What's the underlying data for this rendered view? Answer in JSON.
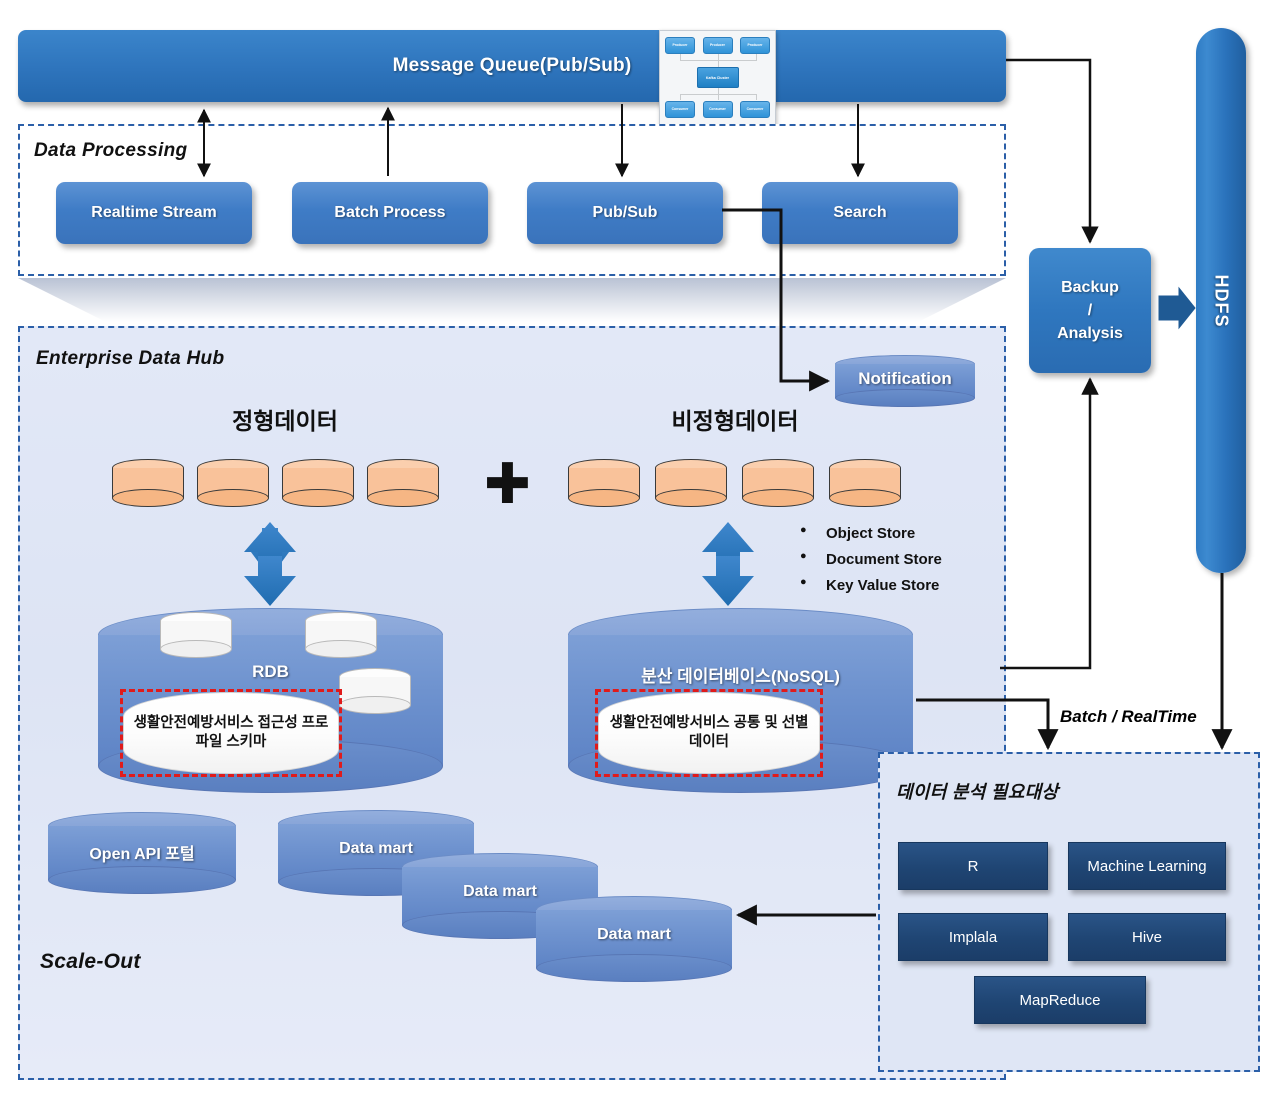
{
  "message_queue": {
    "title": "Message Queue(Pub/Sub)",
    "inset": {
      "name": "kafka-cluster-thumbnail",
      "producers": [
        "Producer",
        "Producer",
        "Producer"
      ],
      "cluster": "Kafka Cluster",
      "consumers": [
        "Consumer",
        "Consumer",
        "Consumer"
      ]
    }
  },
  "data_processing": {
    "title": "Data Processing",
    "boxes": [
      {
        "label": "Realtime Stream"
      },
      {
        "label": "Batch Process"
      },
      {
        "label": "Pub/Sub"
      },
      {
        "label": "Search"
      }
    ]
  },
  "enterprise_data_hub": {
    "title": "Enterprise Data Hub",
    "scale_out": "Scale-Out",
    "structured": {
      "heading": "정형데이터",
      "cylinder_count": 4,
      "db_label": "RDB",
      "highlight": "생활안전예방서비스 접근성 프로파일 스키마"
    },
    "plus": "✚",
    "unstructured": {
      "heading": "비정형데이터",
      "cylinder_count": 4,
      "db_label": "분산 데이터베이스(NoSQL)",
      "highlight": "생활안전예방서비스 공통 및 선별 데이터",
      "store_types": [
        "Object Store",
        "Document Store",
        "Key Value Store"
      ]
    },
    "notification": "Notification",
    "open_api": "Open API 포털",
    "data_marts": [
      "Data mart",
      "Data mart",
      "Data mart"
    ]
  },
  "backup": {
    "lines": [
      "Backup",
      "/",
      "Analysis"
    ]
  },
  "hdfs": {
    "label": "HDFS"
  },
  "analysis_panel": {
    "title": "데이터 분석 필요대상",
    "items": [
      "R",
      "Machine Learning",
      "Implala",
      "Hive",
      "MapReduce"
    ]
  },
  "edge_labels": {
    "batch_realtime": "Batch / RealTime"
  },
  "colors": {
    "primary_blue": "#2e74bc",
    "process_blue": "#3f7cc6",
    "hub_bg": "#dee5f5",
    "orange_cyl": "#f9c29a",
    "db_blue": "#6f93cf",
    "dark_navy": "#1f4573",
    "highlight_red": "#e01b1b",
    "dashed_border": "#2b5fa8"
  }
}
